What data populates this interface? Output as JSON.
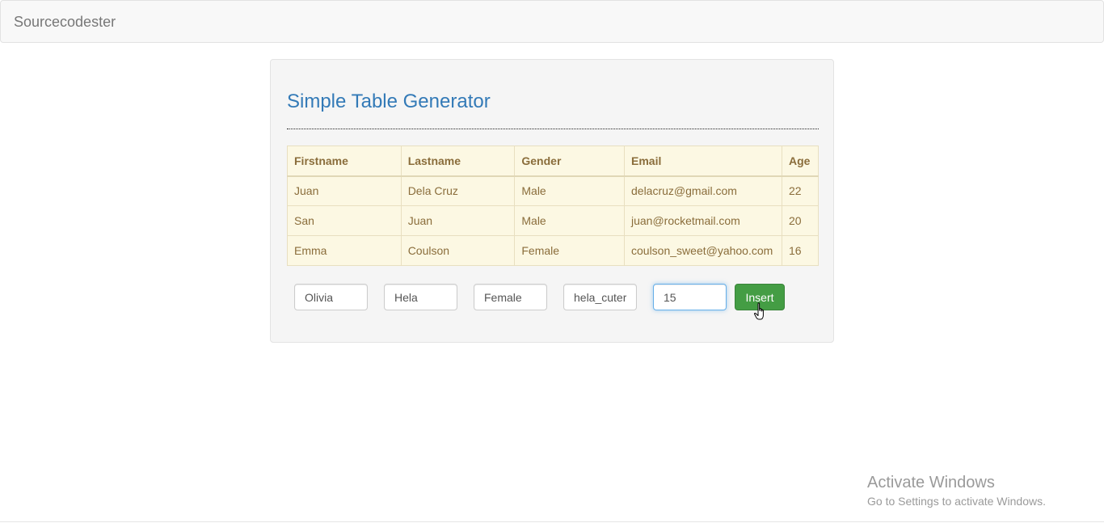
{
  "navbar": {
    "brand": "Sourcecodester"
  },
  "panel": {
    "title": "Simple Table Generator"
  },
  "table": {
    "headers": [
      "Firstname",
      "Lastname",
      "Gender",
      "Email",
      "Age"
    ],
    "rows": [
      [
        "Juan",
        "Dela Cruz",
        "Male",
        "delacruz@gmail.com",
        "22"
      ],
      [
        "San",
        "Juan",
        "Male",
        "juan@rocketmail.com",
        "20"
      ],
      [
        "Emma",
        "Coulson",
        "Female",
        "coulson_sweet@yahoo.com",
        "16"
      ]
    ]
  },
  "form": {
    "firstname": "Olivia",
    "lastname": "Hela",
    "gender": "Female",
    "email": "hela_cuter",
    "age": "15",
    "insert_label": "Insert"
  },
  "watermark": {
    "title": "Activate Windows",
    "subtitle": "Go to Settings to activate Windows."
  },
  "colors": {
    "accent": "#337ab7",
    "table_bg": "#fcf8e3",
    "table_text": "#8a6d3b",
    "success": "#449d44"
  }
}
